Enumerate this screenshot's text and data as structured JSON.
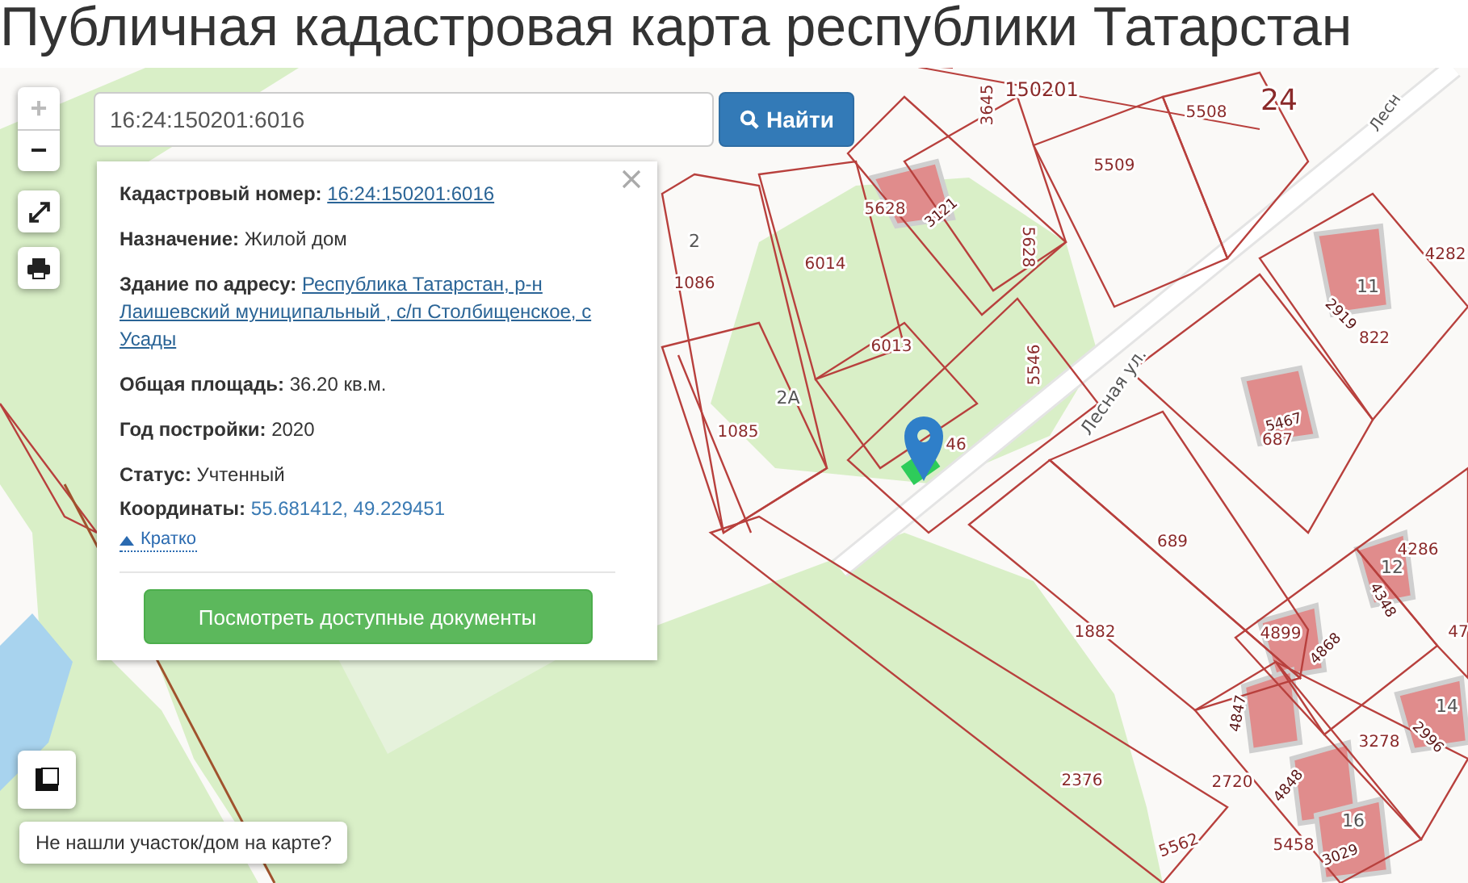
{
  "page_title": "Публичная кадастровая карта республики Татарстан",
  "search": {
    "value": "16:24:150201:6016",
    "button": "Найти"
  },
  "map_controls": [
    {
      "label": "+",
      "disabled": true
    },
    {
      "label": "−",
      "disabled": false
    }
  ],
  "info_popup": {
    "fields": [
      {
        "label": "Кадастровый номер:",
        "value": "16:24:150201:6016",
        "kind": "link"
      },
      {
        "label": "Назначение:",
        "value": "Жилой дом",
        "kind": "text"
      },
      {
        "label": "Здание по адресу:",
        "value": "Республика Татарстан, р-н Лаишевский муниципальный , с/п Столбищенское, с Усады",
        "kind": "link"
      },
      {
        "label": "Общая площадь:",
        "value": "36.20 кв.м.",
        "kind": "text"
      },
      {
        "label": "Год постройки:",
        "value": "2020",
        "kind": "text"
      }
    ],
    "status_fields": [
      {
        "label": "Статус:",
        "value": "Учтенный",
        "kind": "text"
      },
      {
        "label": "Координаты:",
        "value": "55.681412, 49.229451",
        "kind": "coords"
      }
    ],
    "toggle": {
      "label": "Кратко",
      "expanded": true
    },
    "documents_button": "Посмотреть доступные документы"
  },
  "not_found_button": "Не нашли участок/дом на карте?",
  "map_labels": [
    {
      "text": "3645",
      "kind": "parcel"
    },
    {
      "text": "150201",
      "kind": "block"
    },
    {
      "text": "5508",
      "kind": "parcel"
    },
    {
      "text": "24",
      "kind": "block"
    },
    {
      "text": "Лесн",
      "kind": "street"
    },
    {
      "text": "5509",
      "kind": "parcel"
    },
    {
      "text": "5628",
      "kind": "parcel"
    },
    {
      "text": "3121",
      "kind": "building"
    },
    {
      "text": "6014",
      "kind": "parcel"
    },
    {
      "text": "5628",
      "kind": "parcel"
    },
    {
      "text": "2",
      "kind": "house"
    },
    {
      "text": "1086",
      "kind": "parcel"
    },
    {
      "text": "6013",
      "kind": "parcel"
    },
    {
      "text": "5546",
      "kind": "parcel"
    },
    {
      "text": "2А",
      "kind": "house"
    },
    {
      "text": "1085",
      "kind": "parcel"
    },
    {
      "text": "46",
      "kind": "parcel"
    },
    {
      "text": "Лесная ул.",
      "kind": "street"
    },
    {
      "text": "4282",
      "kind": "parcel"
    },
    {
      "text": "11",
      "kind": "house"
    },
    {
      "text": "2919",
      "kind": "building"
    },
    {
      "text": "822",
      "kind": "parcel"
    },
    {
      "text": "5467",
      "kind": "building"
    },
    {
      "text": "687",
      "kind": "parcel"
    },
    {
      "text": "689",
      "kind": "parcel"
    },
    {
      "text": "1882",
      "kind": "parcel"
    },
    {
      "text": "4286",
      "kind": "parcel"
    },
    {
      "text": "12",
      "kind": "house"
    },
    {
      "text": "4348",
      "kind": "building"
    },
    {
      "text": "4899",
      "kind": "parcel"
    },
    {
      "text": "4868",
      "kind": "building"
    },
    {
      "text": "47",
      "kind": "parcel"
    },
    {
      "text": "14",
      "kind": "house"
    },
    {
      "text": "2996",
      "kind": "building"
    },
    {
      "text": "3278",
      "kind": "parcel"
    },
    {
      "text": "2376",
      "kind": "parcel"
    },
    {
      "text": "4847",
      "kind": "building"
    },
    {
      "text": "2720",
      "kind": "parcel"
    },
    {
      "text": "4848",
      "kind": "building"
    },
    {
      "text": "16",
      "kind": "house"
    },
    {
      "text": "5458",
      "kind": "parcel"
    },
    {
      "text": "3029",
      "kind": "building"
    },
    {
      "text": "5562",
      "kind": "parcel"
    }
  ]
}
